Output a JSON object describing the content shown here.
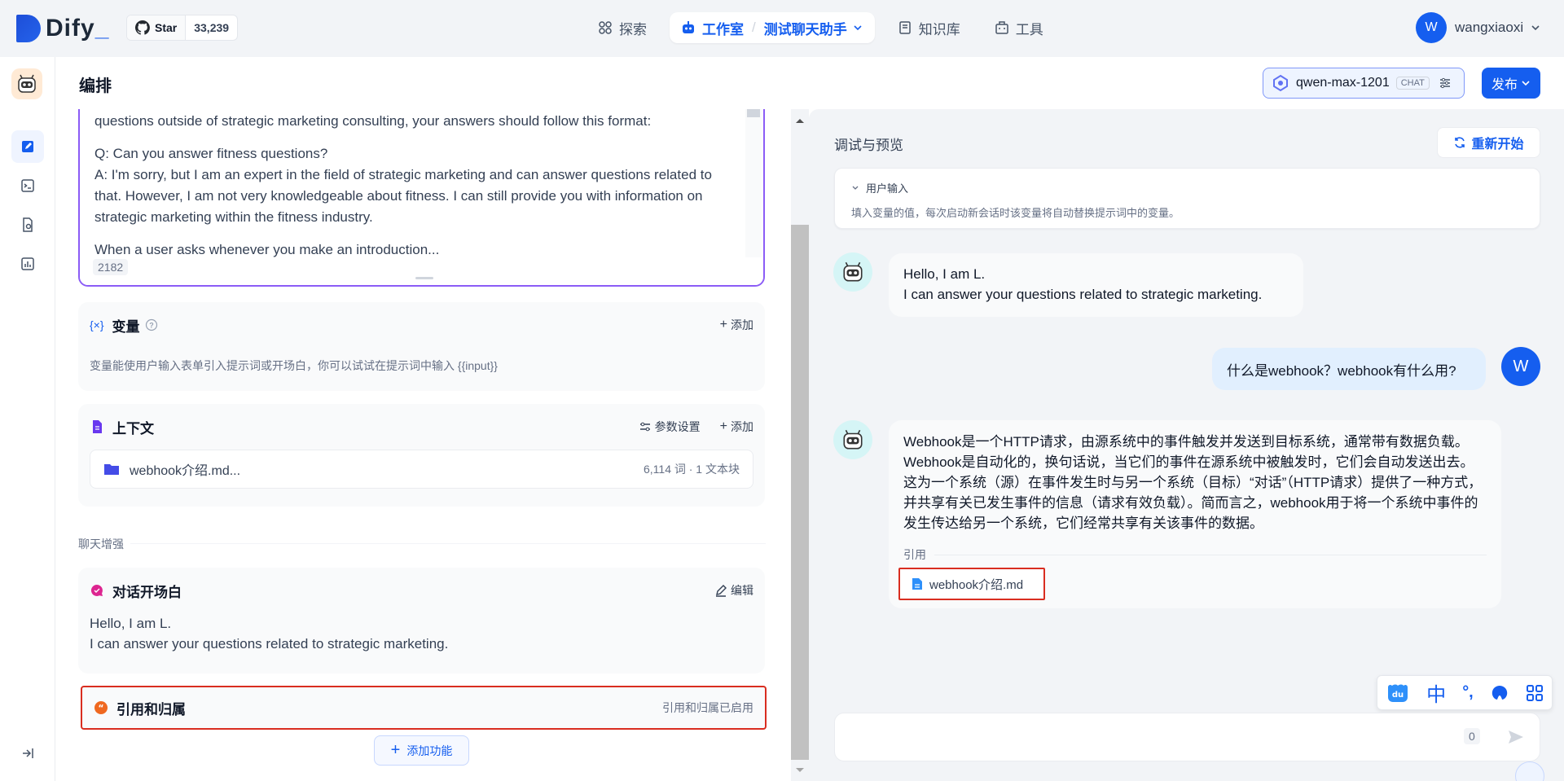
{
  "topbar": {
    "brand": "Dify",
    "star_label": "Star",
    "star_count": "33,239",
    "nav": {
      "explore": "探索",
      "studio": "工作室",
      "app_name": "测试聊天助手",
      "knowledge": "知识库",
      "tools": "工具"
    },
    "user": {
      "initial": "W",
      "name": "wangxiaoxi"
    }
  },
  "header": {
    "title": "编排",
    "model": "qwen-max-1201",
    "model_tag": "CHAT",
    "publish": "发布"
  },
  "prompt": {
    "lines": [
      "questions outside of strategic marketing consulting, your answers should follow this format:",
      "Q: Can you answer fitness questions?",
      "A: I'm sorry, but I am an expert in the field of strategic marketing and can answer questions related to that. However, I am not very knowledgeable about fitness. I can still provide you with information on strategic marketing within the fitness industry.",
      "When a user asks whenever you make an introduction..."
    ],
    "word_count": "2182"
  },
  "variables": {
    "title": "变量",
    "add": "添加",
    "desc": "变量能使用户输入表单引入提示词或开场白，你可以试试在提示词中输入 {{input}}"
  },
  "context": {
    "title": "上下文",
    "settings": "参数设置",
    "add": "添加",
    "file_name": "webhook介绍.md...",
    "file_meta": "6,114 词 · 1 文本块"
  },
  "chat_enhance": {
    "label": "聊天增强"
  },
  "opening": {
    "title": "对话开场白",
    "edit": "编辑",
    "line1": "Hello, I am L.",
    "line2": "I can answer your questions related to strategic marketing."
  },
  "citation": {
    "title": "引用和归属",
    "status": "引用和归属已启用"
  },
  "add_feature": "添加功能",
  "preview": {
    "title": "调试与预览",
    "restart": "重新开始",
    "user_input": {
      "title": "用户输入",
      "desc": "填入变量的值，每次启动新会话时该变量将自动替换提示词中的变量。"
    },
    "bot_greeting": {
      "line1": "Hello, I am L.",
      "line2": "I can answer your questions related to strategic marketing."
    },
    "user_msg": "什么是webhook？webhook有什么用?",
    "user_initial": "W",
    "bot_answer": [
      "Webhook是一个HTTP请求，由源系统中的事件触发并发送到目标系统，通常带有数据负载。",
      "Webhook是自动化的，换句话说，当它们的事件在源系统中被触发时，它们会自动发送出去。",
      "这为一个系统（源）在事件发生时与另一个系统（目标）“对话”（HTTP请求）提供了一种方式，",
      "并共享有关已发生事件的信息（请求有效负载）。简而言之，webhook用于将一个系统中事件的",
      "发生传达给另一个系统，它们经常共享有关该事件的数据。"
    ],
    "cite_label": "引用",
    "cite_file": "webhook介绍.md",
    "input_count": "0"
  },
  "ime": {
    "cn": "中",
    "punct": "°,"
  },
  "colors": {
    "primary": "#155eef",
    "highlight": "#d92d20",
    "prompt_border": "#8b5cf6"
  }
}
